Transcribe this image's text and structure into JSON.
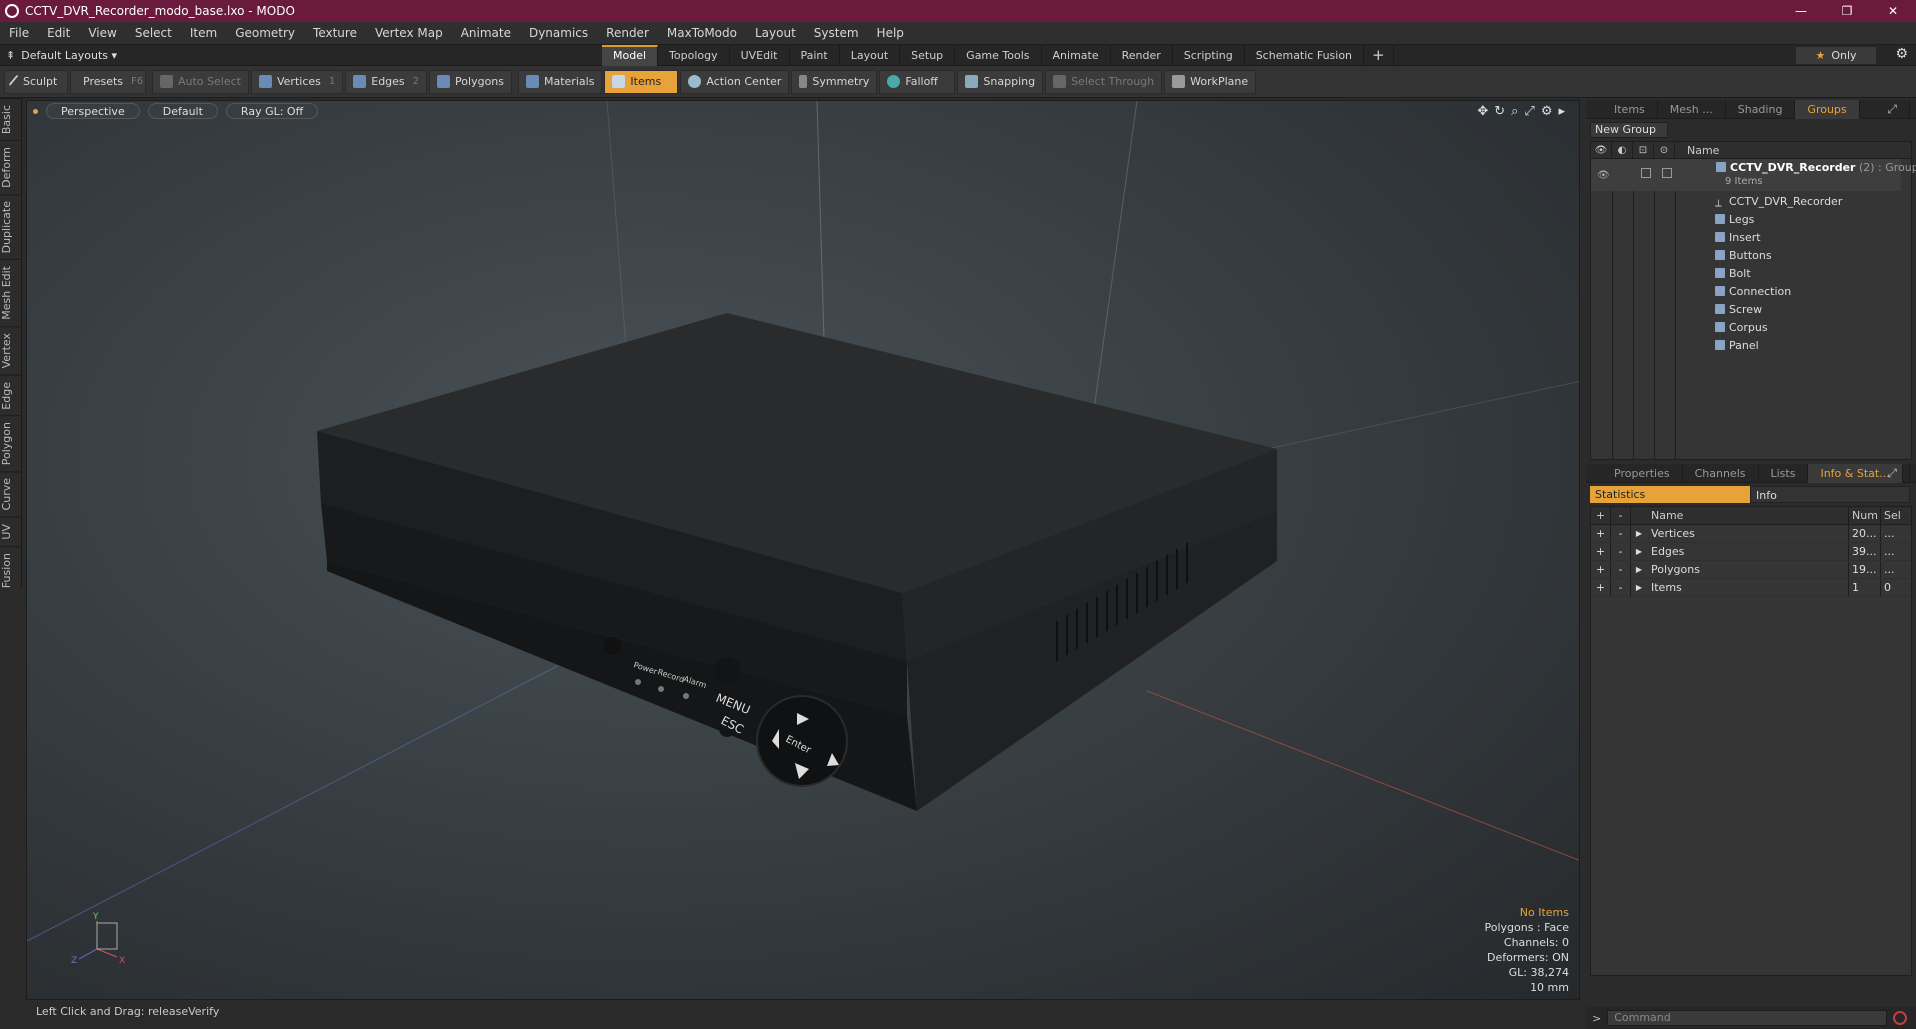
{
  "window": {
    "title": "CCTV_DVR_Recorder_modo_base.lxo - MODO",
    "controls": [
      "—",
      "❐",
      "✕"
    ]
  },
  "menu": [
    "File",
    "Edit",
    "View",
    "Select",
    "Item",
    "Geometry",
    "Texture",
    "Vertex Map",
    "Animate",
    "Dynamics",
    "Render",
    "MaxToModo",
    "Layout",
    "System",
    "Help"
  ],
  "layout_bar": {
    "preset": "Default Layouts ▾",
    "tabs": [
      "Model",
      "Topology",
      "UVEdit",
      "Paint",
      "Layout",
      "Setup",
      "Game Tools",
      "Animate",
      "Render",
      "Scripting",
      "Schematic Fusion"
    ],
    "active_tab": "Model",
    "only_label": "Only"
  },
  "toolbar": {
    "sculpt": "Sculpt",
    "presets": "Presets",
    "presets_key": "F6",
    "auto_select": "Auto Select",
    "vertices": "Vertices",
    "vertices_key": "1",
    "edges": "Edges",
    "edges_key": "2",
    "polygons": "Polygons",
    "materials": "Materials",
    "items": "Items",
    "action_center": "Action Center",
    "symmetry": "Symmetry",
    "falloff": "Falloff",
    "snapping": "Snapping",
    "select_through": "Select Through",
    "workplane": "WorkPlane"
  },
  "left_tabs": [
    "Basic",
    "Deform",
    "Duplicate",
    "Mesh Edit",
    "Vertex",
    "Edge",
    "Polygon",
    "Curve",
    "UV",
    "Fusion"
  ],
  "viewport": {
    "view": "Perspective",
    "shading": "Default",
    "raygl": "Ray GL: Off",
    "device_labels": [
      "Power",
      "Record",
      "Alarm",
      "MENU",
      "ESC",
      "Enter"
    ],
    "info": {
      "status": "No Items",
      "polygons": "Polygons : Face",
      "channels": "Channels: 0",
      "deformers": "Deformers: ON",
      "gl": "GL: 38,274",
      "unit": "10 mm"
    },
    "axis_labels": [
      "Y",
      "Z",
      "X"
    ]
  },
  "statusbar": "Left Click and Drag:  releaseVerify",
  "groups_panel": {
    "tabs": [
      "Items",
      "Mesh ...",
      "Shading",
      "Groups"
    ],
    "active_tab": "Groups",
    "new_group": "New Group",
    "name_header": "Name",
    "group": {
      "name": "CCTV_DVR_Recorder",
      "suffix": " (2) : Group",
      "count": "9 Items"
    },
    "items": [
      "CCTV_DVR_Recorder",
      "Legs",
      "Insert",
      "Buttons",
      "Bolt",
      "Connection",
      "Screw",
      "Corpus",
      "Panel"
    ]
  },
  "info_panel": {
    "tabs": [
      "Properties",
      "Channels",
      "Lists",
      "Info & Stat..."
    ],
    "active_tab": "Info & Stat...",
    "subtabs": [
      "Statistics",
      "Info"
    ],
    "headers": {
      "name": "Name",
      "num": "Num",
      "sel": "Sel"
    },
    "rows": [
      {
        "name": "Vertices",
        "num": "20...",
        "sel": "..."
      },
      {
        "name": "Edges",
        "num": "39...",
        "sel": "..."
      },
      {
        "name": "Polygons",
        "num": "19...",
        "sel": "..."
      },
      {
        "name": "Items",
        "num": "1",
        "sel": "0"
      }
    ]
  },
  "command": {
    "placeholder": "Command"
  }
}
